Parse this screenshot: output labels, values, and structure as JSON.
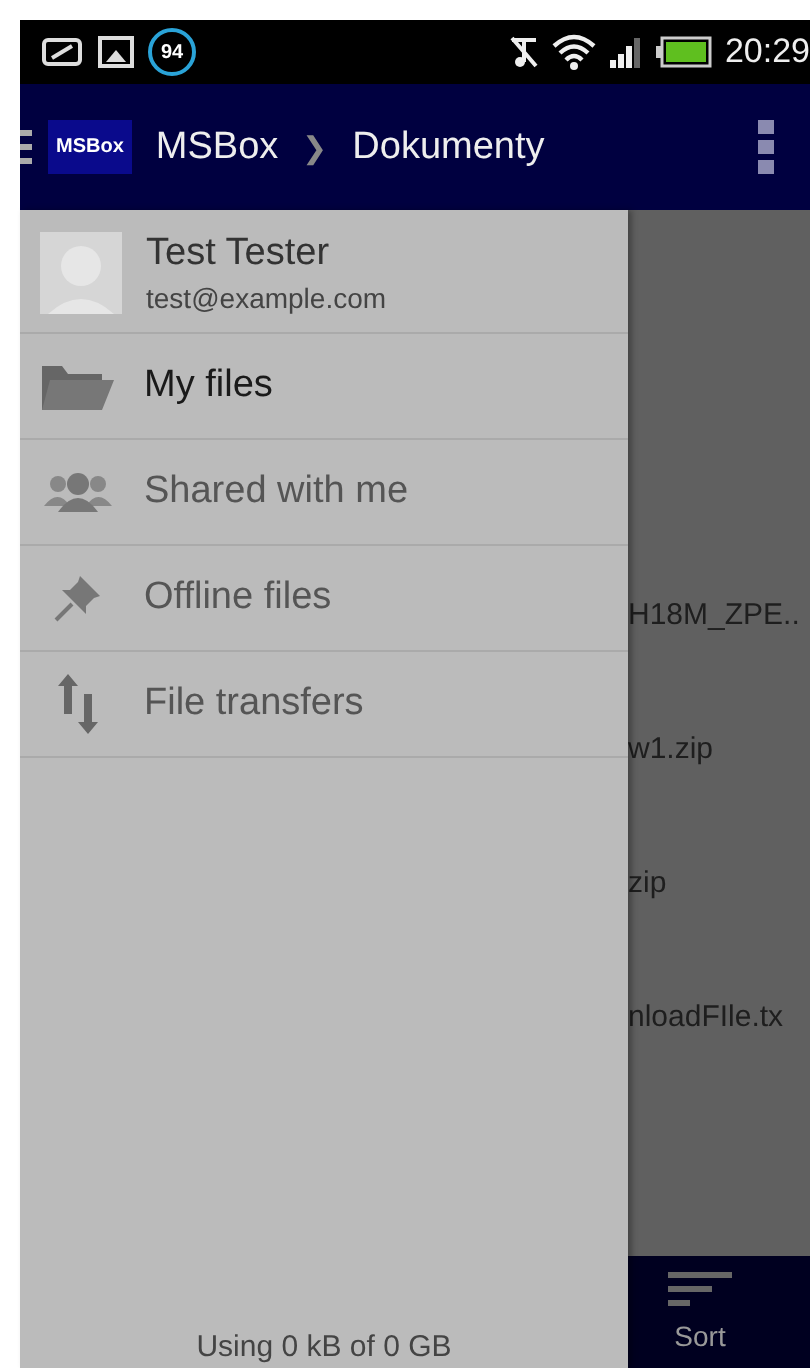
{
  "status_bar": {
    "notification_badge": "94",
    "time": "20:29"
  },
  "app_bar": {
    "logo": "MSBox",
    "breadcrumbs": [
      "MSBox",
      "Dokumenty"
    ],
    "separator": "❯"
  },
  "drawer": {
    "user": {
      "name": "Test Tester",
      "email": "test@example.com"
    },
    "items": [
      {
        "label": "My files",
        "kind": "folder",
        "selected": true
      },
      {
        "label": "Shared with me",
        "kind": "people",
        "selected": false
      },
      {
        "label": "Offline files",
        "kind": "pin",
        "selected": false
      },
      {
        "label": "File transfers",
        "kind": "transfer",
        "selected": false
      }
    ],
    "footer": "Using 0 kB of 0 GB"
  },
  "files": [
    "H18M_ZPE..",
    "w1.zip",
    "zip",
    "nloadFIle.tx"
  ],
  "bottom_bar": {
    "actions": [
      {
        "label": "Sort"
      }
    ]
  }
}
